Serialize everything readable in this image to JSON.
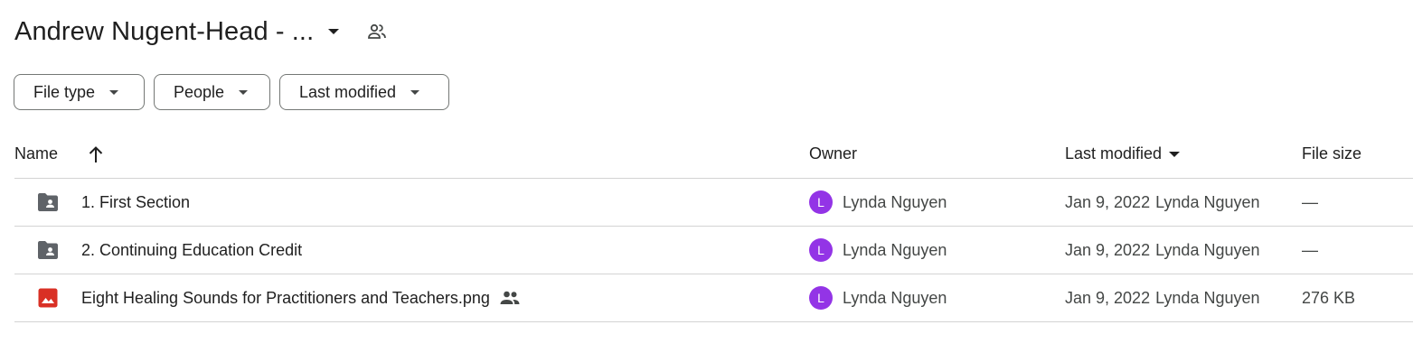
{
  "header": {
    "title": "Andrew Nugent-Head - ...",
    "dropdown_icon": "arrow-drop-down-icon",
    "shared_icon": "people-icon"
  },
  "filters": [
    {
      "label": "File type"
    },
    {
      "label": "People"
    },
    {
      "label": "Last modified"
    }
  ],
  "columns": {
    "name": "Name",
    "owner": "Owner",
    "last_modified": "Last modified",
    "file_size": "File size",
    "sort_direction_icon": "arrow-up-icon"
  },
  "rows": [
    {
      "type": "shared-folder",
      "name": "1. First Section",
      "owner_initial": "L",
      "owner": "Lynda Nguyen",
      "modified_date": "Jan 9, 2022",
      "modified_by": "Lynda Nguyen",
      "size": "—",
      "shared": false
    },
    {
      "type": "shared-folder",
      "name": "2. Continuing Education Credit",
      "owner_initial": "L",
      "owner": "Lynda Nguyen",
      "modified_date": "Jan 9, 2022",
      "modified_by": "Lynda Nguyen",
      "size": "—",
      "shared": false
    },
    {
      "type": "image",
      "name": "Eight Healing Sounds for Practitioners and Teachers.png",
      "owner_initial": "L",
      "owner": "Lynda Nguyen",
      "modified_date": "Jan 9, 2022",
      "modified_by": "Lynda Nguyen",
      "size": "276 KB",
      "shared": true
    }
  ],
  "colors": {
    "avatar": "#9334e6",
    "folder_icon": "#5f6368",
    "image_icon": "#d93025",
    "divider": "#d3d3d3"
  }
}
